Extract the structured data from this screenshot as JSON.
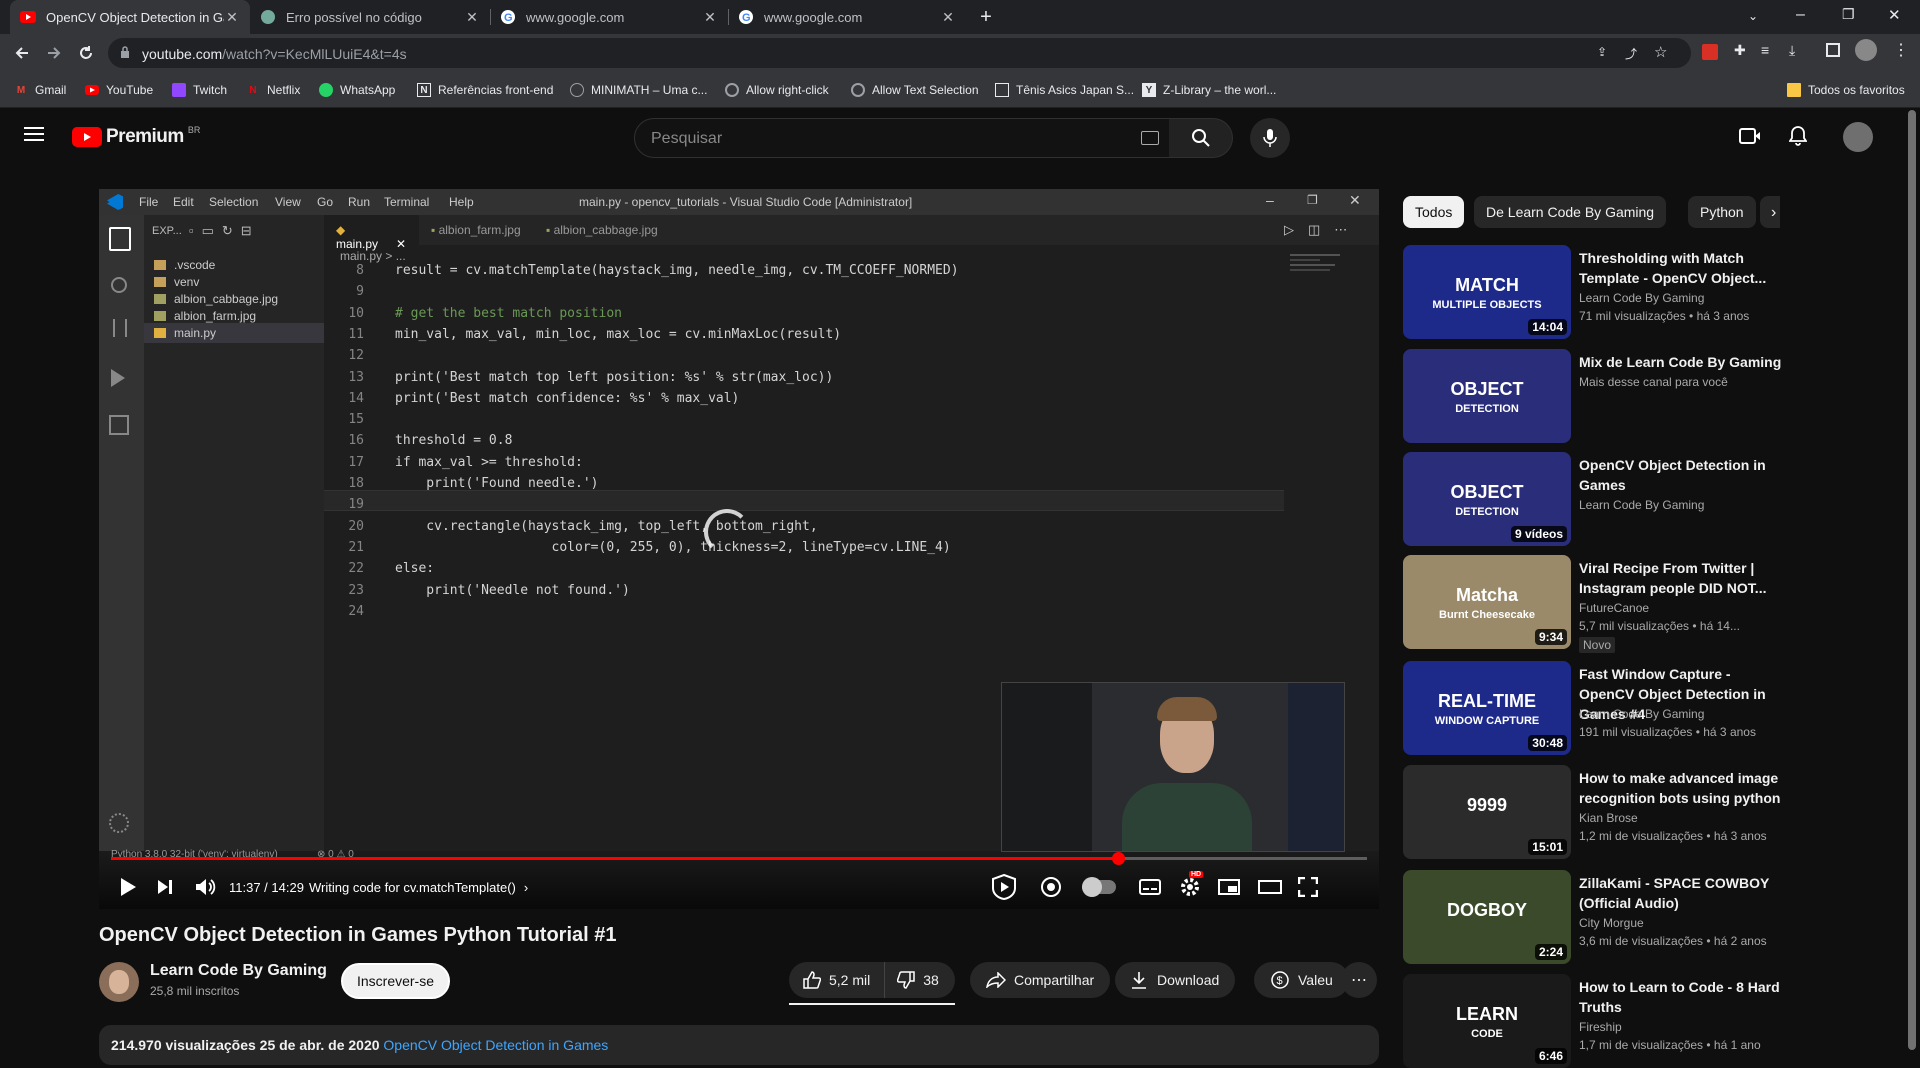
{
  "browser": {
    "tabs": [
      {
        "title": "OpenCV Object Detection in Gar",
        "active": true
      },
      {
        "title": "Erro possível no código",
        "active": false
      },
      {
        "title": "www.google.com",
        "active": false
      },
      {
        "title": "www.google.com",
        "active": false
      }
    ],
    "new_tab": "+",
    "url_host": "youtube.com",
    "url_path": "/watch?v=KecMlLUuiE4&t=4s",
    "bookmarks": [
      "Gmail",
      "YouTube",
      "Twitch",
      "Netflix",
      "WhatsApp",
      "Referências front-end",
      "MINIMATH – Uma c...",
      "Allow right-click",
      "Allow Text Selection",
      "Tênis Asics Japan S...",
      "Z-Library – the worl..."
    ],
    "bookmarks_folder": "Todos os favoritos"
  },
  "header": {
    "logo_text": "Premium",
    "region": "BR",
    "search_placeholder": "Pesquisar"
  },
  "vscode": {
    "menus": [
      "File",
      "Edit",
      "Selection",
      "View",
      "Go",
      "Run",
      "Terminal",
      "Help"
    ],
    "title": "main.py - opencv_tutorials - Visual Studio Code [Administrator]",
    "explorer_label": "EXP...",
    "files": [
      ".vscode",
      "venv",
      "albion_cabbage.jpg",
      "albion_farm.jpg",
      "main.py"
    ],
    "editor_tabs": [
      "main.py",
      "albion_farm.jpg",
      "albion_cabbage.jpg"
    ],
    "breadcrumb": "main.py > ...",
    "code": [
      {
        "n": "8",
        "t": "result = cv.matchTemplate(haystack_img, needle_img, cv.TM_CCOEFF_NORMED)"
      },
      {
        "n": "9",
        "t": ""
      },
      {
        "n": "10",
        "t": "# get the best match position"
      },
      {
        "n": "11",
        "t": "min_val, max_val, min_loc, max_loc = cv.minMaxLoc(result)"
      },
      {
        "n": "12",
        "t": ""
      },
      {
        "n": "13",
        "t": "print('Best match top left position: %s' % str(max_loc))"
      },
      {
        "n": "14",
        "t": "print('Best match confidence: %s' % max_val)"
      },
      {
        "n": "15",
        "t": ""
      },
      {
        "n": "16",
        "t": "threshold = 0.8"
      },
      {
        "n": "17",
        "t": "if max_val >= threshold:"
      },
      {
        "n": "18",
        "t": "    print('Found needle.')"
      },
      {
        "n": "19",
        "t": ""
      },
      {
        "n": "20",
        "t": "    cv.rectangle(haystack_img, top_left, bottom_right,"
      },
      {
        "n": "21",
        "t": "                    color=(0, 255, 0), thickness=2, lineType=cv.LINE_4)"
      },
      {
        "n": "22",
        "t": "else:"
      },
      {
        "n": "23",
        "t": "    print('Needle not found.')"
      },
      {
        "n": "24",
        "t": ""
      }
    ],
    "status_left": "Python 3.8.0 32-bit ('venv': virtualenv)",
    "status_problems": "⊗ 0 ⚠ 0"
  },
  "player": {
    "time": "11:37 / 14:29",
    "chapter": "Writing code for cv.matchTemplate()",
    "progress": 0.802,
    "hd_badge": "HD"
  },
  "video": {
    "title": "OpenCV Object Detection in Games Python Tutorial #1",
    "channel": "Learn Code By Gaming",
    "subscribers": "25,8 mil inscritos",
    "subscribe_label": "Inscrever-se",
    "likes": "5,2 mil",
    "dislikes": "38",
    "share": "Compartilhar",
    "download": "Download",
    "thanks": "Valeu",
    "views": "214.970 visualizações",
    "date": "25 de abr. de 2020",
    "playlist_link": "OpenCV Object Detection in Games"
  },
  "chips": [
    "Todos",
    "De Learn Code By Gaming",
    "Python"
  ],
  "recommendations": [
    {
      "title": "Thresholding with Match Template - OpenCV Object...",
      "channel": "Learn Code By Gaming",
      "meta": "71 mil visualizações • há 3 anos",
      "duration": "14:04",
      "thumb_text": "MATCH",
      "thumb_sub": "MULTIPLE OBJECTS",
      "color": "#1d2a8a"
    },
    {
      "title": "Mix de Learn Code By Gaming",
      "channel": "Mais desse canal para você",
      "meta": "",
      "duration": "",
      "thumb_text": "OBJECT",
      "thumb_sub": "DETECTION",
      "color": "#2a2d7a"
    },
    {
      "title": "OpenCV Object Detection in Games",
      "channel": "Learn Code By Gaming",
      "meta": "",
      "duration": "9 vídeos",
      "thumb_text": "OBJECT",
      "thumb_sub": "DETECTION",
      "color": "#2a2d7a"
    },
    {
      "title": "Viral Recipe From Twitter | Instagram people DID NOT...",
      "channel": "FutureCanoe",
      "meta": "5,7 mil visualizações • há 14...",
      "badge": "Novo",
      "duration": "9:34",
      "thumb_text": "Matcha",
      "thumb_sub": "Burnt Cheesecake",
      "color": "#9a8a6a"
    },
    {
      "title": "Fast Window Capture - OpenCV Object Detection in Games #4",
      "channel": "Learn Code By Gaming",
      "meta": "191 mil visualizações • há 3 anos",
      "duration": "30:48",
      "thumb_text": "REAL-TIME",
      "thumb_sub": "WINDOW CAPTURE",
      "color": "#1d2a8a"
    },
    {
      "title": "How to make advanced image recognition bots using python",
      "channel": "Kian Brose",
      "meta": "1,2 mi de visualizações • há 3 anos",
      "duration": "15:01",
      "thumb_text": "9999",
      "thumb_sub": "",
      "color": "#2b2b2b"
    },
    {
      "title": "ZillaKami - SPACE COWBOY (Official Audio)",
      "channel": "City Morgue",
      "meta": "3,6 mi de visualizações • há 2 anos",
      "duration": "2:24",
      "thumb_text": "DOGBOY",
      "thumb_sub": "",
      "color": "#3a4a2a"
    },
    {
      "title": "How to Learn to Code - 8 Hard Truths",
      "channel": "Fireship",
      "meta": "1,7 mi de visualizações • há 1 ano",
      "duration": "6:46",
      "thumb_text": "LEARN",
      "thumb_sub": "CODE",
      "color": "#1a1a1a"
    }
  ]
}
